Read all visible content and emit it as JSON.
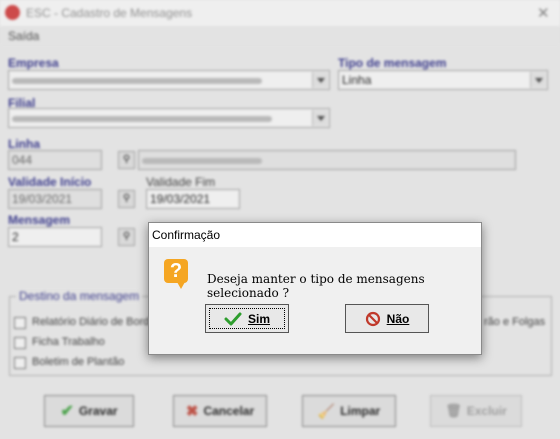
{
  "window": {
    "title": "ESC - Cadastro de Mensagens"
  },
  "menu": {
    "items": [
      "Saída"
    ]
  },
  "form": {
    "empresa_label": "Empresa",
    "tipo_label": "Tipo de mensagem",
    "tipo_value": "Linha",
    "filial_label": "Filial",
    "linha_label": "Linha",
    "linha_code": "044",
    "validade_inicio_label": "Validade Início",
    "validade_inicio_value": "19/03/2021",
    "validade_fim_label": "Validade Fim",
    "validade_fim_value": "19/03/2021",
    "mensagem_label": "Mensagem",
    "mensagem_value": "2"
  },
  "destino": {
    "label": "Destino da mensagem",
    "options": [
      "Relatório Diário de Bordo",
      "Ficha Trabalho",
      "Boletim de Plantão"
    ],
    "right_option_partial": "rão e Folgas"
  },
  "buttons": {
    "gravar": "Gravar",
    "cancelar": "Cancelar",
    "limpar": "Limpar",
    "excluir": "Excluir"
  },
  "dialog": {
    "title": "Confirmação",
    "message": "Deseja manter o tipo de mensagens selecionado ?",
    "yes_label": "Sim",
    "no_label": "Não",
    "icon": "question-icon"
  },
  "colors": {
    "label_blue": "#1a1a80",
    "question_orange": "#f5a623",
    "yes_green": "#2e9e2e",
    "no_red": "#c0392b"
  }
}
